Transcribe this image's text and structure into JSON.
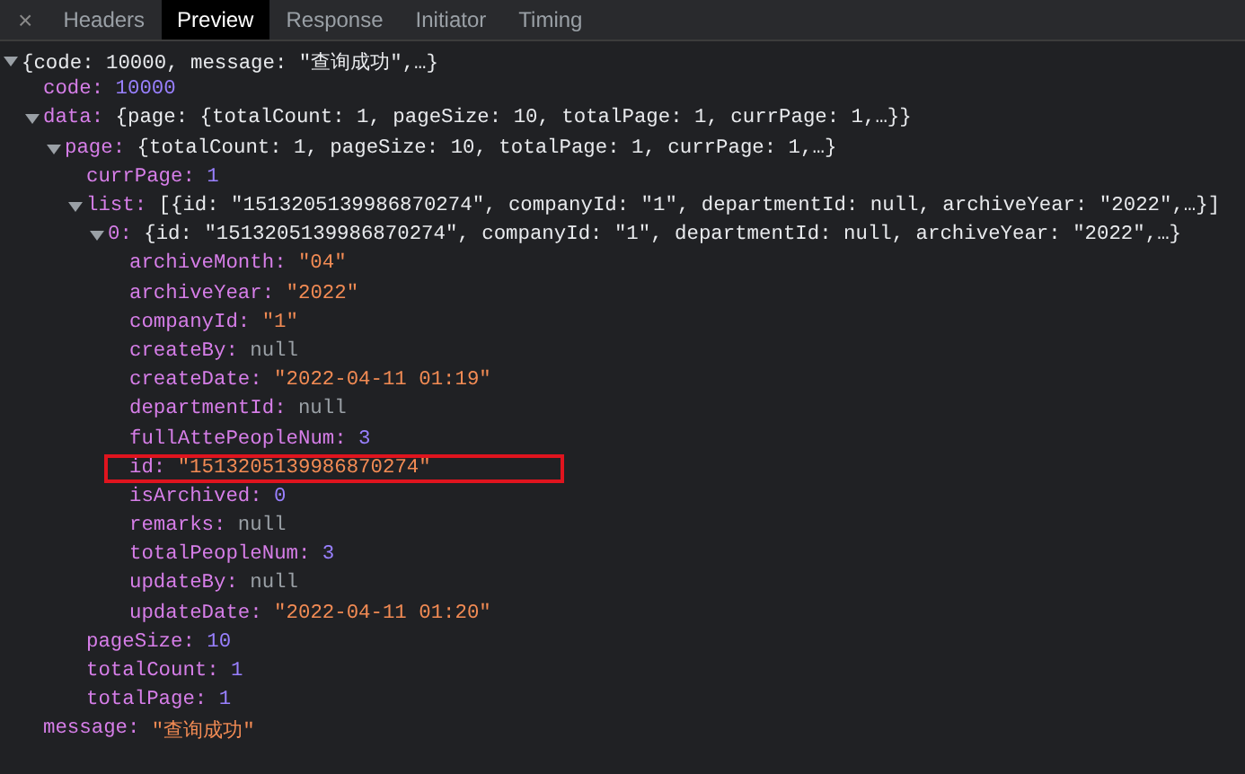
{
  "close_icon": "×",
  "tabs": [
    {
      "label": "Headers",
      "selected": false
    },
    {
      "label": "Preview",
      "selected": true
    },
    {
      "label": "Response",
      "selected": false
    },
    {
      "label": "Initiator",
      "selected": false
    },
    {
      "label": "Timing",
      "selected": false
    }
  ],
  "tree": [
    {
      "kind": "summary",
      "value": "{code: 10000, message: \"查询成功\",…}",
      "expanded": true,
      "children": [
        {
          "kind": "number",
          "key": "code:",
          "value": "10000"
        },
        {
          "kind": "summary",
          "key": "data:",
          "value": "{page: {totalCount: 1, pageSize: 10, totalPage: 1, currPage: 1,…}}",
          "expanded": true,
          "children": [
            {
              "kind": "summary",
              "key": "page:",
              "value": "{totalCount: 1, pageSize: 10, totalPage: 1, currPage: 1,…}",
              "expanded": true,
              "children": [
                {
                  "kind": "number",
                  "key": "currPage:",
                  "value": "1"
                },
                {
                  "kind": "summary",
                  "key": "list:",
                  "value": "[{id: \"1513205139986870274\", companyId: \"1\", departmentId: null, archiveYear: \"2022\",…}]",
                  "expanded": true,
                  "children": [
                    {
                      "kind": "summary",
                      "key": "0:",
                      "value": "{id: \"1513205139986870274\", companyId: \"1\", departmentId: null, archiveYear: \"2022\",…}",
                      "expanded": true,
                      "children": [
                        {
                          "kind": "string",
                          "key": "archiveMonth:",
                          "value": "\"04\""
                        },
                        {
                          "kind": "string",
                          "key": "archiveYear:",
                          "value": "\"2022\""
                        },
                        {
                          "kind": "string",
                          "key": "companyId:",
                          "value": "\"1\""
                        },
                        {
                          "kind": "null",
                          "key": "createBy:",
                          "value": "null"
                        },
                        {
                          "kind": "string",
                          "key": "createDate:",
                          "value": "\"2022-04-11 01:19\""
                        },
                        {
                          "kind": "null",
                          "key": "departmentId:",
                          "value": "null"
                        },
                        {
                          "kind": "number",
                          "key": "fullAttePeopleNum:",
                          "value": "3"
                        },
                        {
                          "kind": "string",
                          "key": "id:",
                          "value": "\"1513205139986870274\"",
                          "highlighted": true
                        },
                        {
                          "kind": "number",
                          "key": "isArchived:",
                          "value": "0"
                        },
                        {
                          "kind": "null",
                          "key": "remarks:",
                          "value": "null"
                        },
                        {
                          "kind": "number",
                          "key": "totalPeopleNum:",
                          "value": "3"
                        },
                        {
                          "kind": "null",
                          "key": "updateBy:",
                          "value": "null"
                        },
                        {
                          "kind": "string",
                          "key": "updateDate:",
                          "value": "\"2022-04-11 01:20\""
                        }
                      ]
                    }
                  ]
                },
                {
                  "kind": "number",
                  "key": "pageSize:",
                  "value": "10"
                },
                {
                  "kind": "number",
                  "key": "totalCount:",
                  "value": "1"
                },
                {
                  "kind": "number",
                  "key": "totalPage:",
                  "value": "1"
                }
              ]
            }
          ]
        },
        {
          "kind": "string",
          "key": "message:",
          "value": "\"查询成功\""
        }
      ]
    }
  ]
}
